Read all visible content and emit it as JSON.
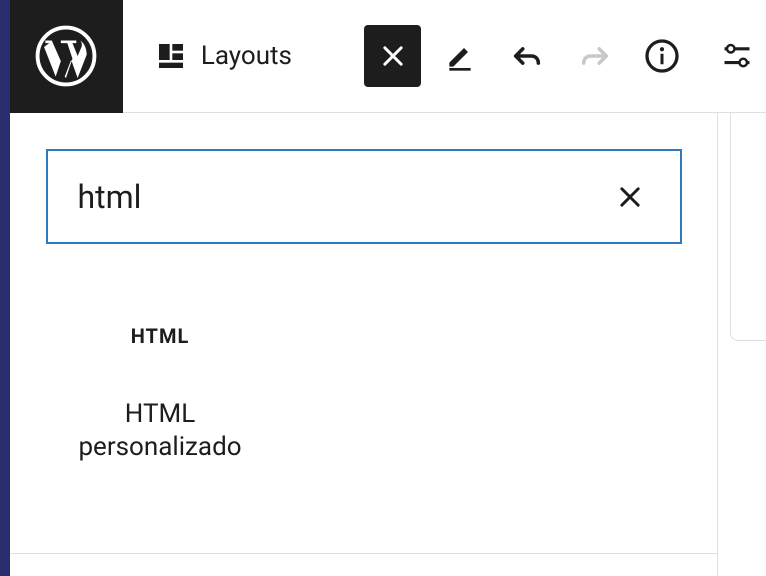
{
  "toolbar": {
    "layouts_label": "Layouts"
  },
  "search": {
    "value": "html",
    "placeholder": ""
  },
  "results": [
    {
      "icon_text": "HTML",
      "label": "HTML personalizado"
    }
  ]
}
